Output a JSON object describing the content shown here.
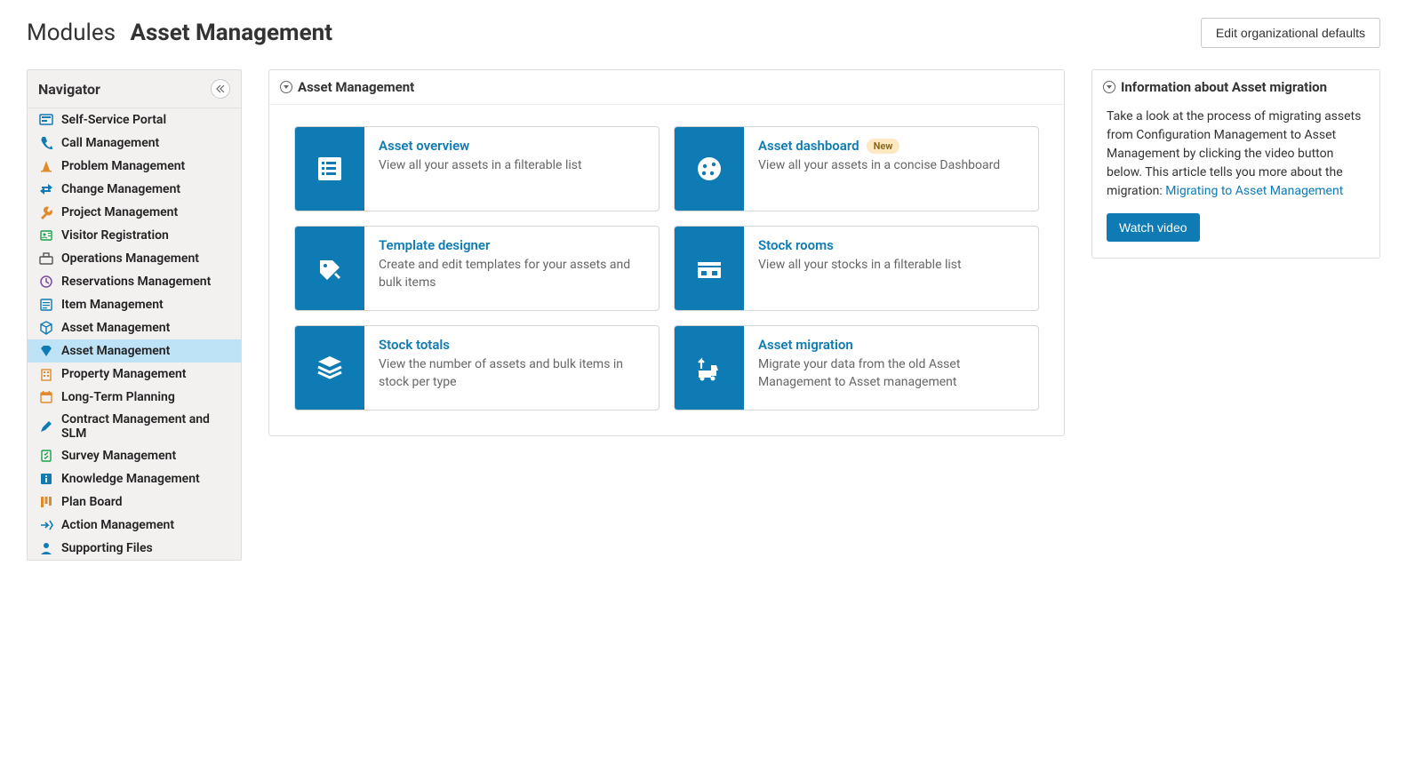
{
  "breadcrumb": {
    "first": "Modules",
    "second": "Asset Management"
  },
  "editDefaultsLabel": "Edit organizational defaults",
  "sidebar": {
    "title": "Navigator",
    "items": [
      {
        "label": "Self-Service Portal",
        "icon": "portal",
        "color": "#0f7bb4"
      },
      {
        "label": "Call Management",
        "icon": "phone",
        "color": "#0f7bb4"
      },
      {
        "label": "Problem Management",
        "icon": "cone",
        "color": "#e08b2b"
      },
      {
        "label": "Change Management",
        "icon": "change",
        "color": "#0f7bb4"
      },
      {
        "label": "Project Management",
        "icon": "wrench",
        "color": "#e08b2b"
      },
      {
        "label": "Visitor Registration",
        "icon": "visitor",
        "color": "#19a24a"
      },
      {
        "label": "Operations Management",
        "icon": "ops",
        "color": "#555"
      },
      {
        "label": "Reservations Management",
        "icon": "clock",
        "color": "#7a4aa0"
      },
      {
        "label": "Item Management",
        "icon": "item",
        "color": "#0f7bb4"
      },
      {
        "label": "Asset Management",
        "icon": "cube",
        "color": "#0f7bb4"
      },
      {
        "label": "Asset Management",
        "icon": "gem",
        "color": "#0f7bb4",
        "active": true
      },
      {
        "label": "Property Management",
        "icon": "building",
        "color": "#e08b2b"
      },
      {
        "label": "Long-Term Planning",
        "icon": "calendar",
        "color": "#e08b2b"
      },
      {
        "label": "Contract Management and SLM",
        "icon": "pen",
        "color": "#0f7bb4"
      },
      {
        "label": "Survey Management",
        "icon": "survey",
        "color": "#19a24a"
      },
      {
        "label": "Knowledge Management",
        "icon": "info",
        "color": "#0f7bb4"
      },
      {
        "label": "Plan Board",
        "icon": "board",
        "color": "#e08b2b"
      },
      {
        "label": "Action Management",
        "icon": "action",
        "color": "#0f7bb4"
      },
      {
        "label": "Supporting Files",
        "icon": "person",
        "color": "#0f7bb4"
      }
    ]
  },
  "mainPanel": {
    "title": "Asset Management",
    "cards": [
      {
        "title": "Asset overview",
        "desc": "View all your assets in a filterable list",
        "icon": "list",
        "badge": null
      },
      {
        "title": "Asset dashboard",
        "desc": "View all your assets in a concise Dashboard",
        "icon": "dashboard",
        "badge": "New"
      },
      {
        "title": "Template designer",
        "desc": "Create and edit templates for your assets and bulk items",
        "icon": "template",
        "badge": null
      },
      {
        "title": "Stock rooms",
        "desc": "View all your stocks in a filterable list",
        "icon": "rooms",
        "badge": null
      },
      {
        "title": "Stock totals",
        "desc": "View the number of assets and bulk items in stock per type",
        "icon": "stack",
        "badge": null
      },
      {
        "title": "Asset migration",
        "desc": "Migrate your data from the old Asset Management to Asset management",
        "icon": "migration",
        "badge": null
      }
    ]
  },
  "infoPanel": {
    "title": "Information about Asset migration",
    "text": "Take a look at the process of migrating assets from Configuration Management to Asset Management by clicking the video button below. This article tells you more about the migration:",
    "linkText": "Migrating to Asset Management",
    "buttonLabel": "Watch video"
  }
}
